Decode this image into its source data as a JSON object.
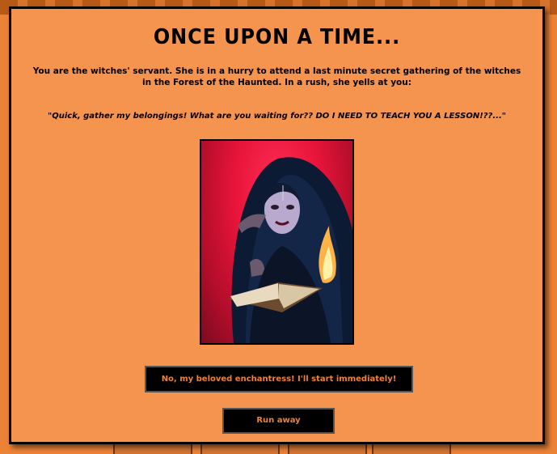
{
  "modal": {
    "title": "ONCE UPON A TIME...",
    "intro": "You are the witches' servant. She is in a hurry to attend a last minute secret gathering of the witches in the Forest of the Haunted. In a rush, she yells at you:",
    "quote": "\"Quick, gather my belongings! What are you waiting for?? DO I NEED TO TEACH YOU A LESSON!??...\"",
    "image_subject": "witch-with-burning-book",
    "choices": [
      {
        "label": "No, my beloved enchantress! I'll start immediately!"
      },
      {
        "label": "Run away"
      }
    ]
  },
  "colors": {
    "page_background": "#ec8236",
    "modal_background": "#f5944f",
    "button_background": "#000000",
    "button_text": "#ec8236",
    "photo_accent": "#e8143a"
  }
}
